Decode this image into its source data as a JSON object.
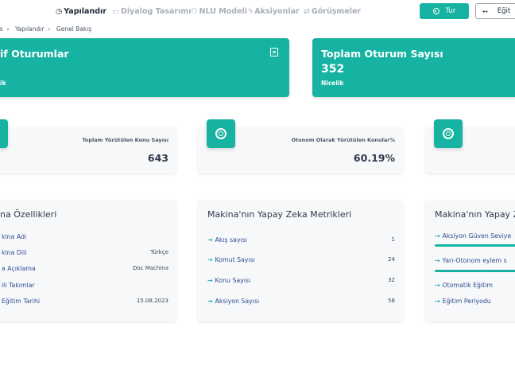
{
  "nav": {
    "items": [
      {
        "label": "Yapılandır",
        "icon": "clock-icon",
        "active": true
      },
      {
        "label": "Diyalog Tasarımı",
        "icon": "chat-icon",
        "active": false
      },
      {
        "label": "NLU Modeli",
        "icon": "users-icon",
        "active": false
      },
      {
        "label": "Aksiyonlar",
        "icon": "bolt-icon",
        "active": false
      },
      {
        "label": "Görüşmeler",
        "icon": "refresh-icon",
        "active": false
      }
    ],
    "run_label": "Tur",
    "train_label": "Eğit"
  },
  "breadcrumb": [
    "na",
    "Yapılandır",
    "Genel Bakış"
  ],
  "summary_cards": [
    {
      "title": "if Oturumlar",
      "value": "",
      "sub": "ik"
    },
    {
      "title": "Toplam Oturum Sayısı",
      "value": "352",
      "sub": "Nicelik"
    }
  ],
  "stats": [
    {
      "label": "Toplam Yürütülen Konu Sayısı",
      "value": "643"
    },
    {
      "label": "Otonom Olarak Yürütülen Konular%",
      "value": "60.19%"
    },
    {
      "label": "",
      "value": ""
    }
  ],
  "features_card": {
    "title": "na Özellikleri",
    "rows": [
      {
        "key": "kina Adı",
        "value": ""
      },
      {
        "key": "kina Dili",
        "value": "Türkçe"
      },
      {
        "key": "a Açıklama",
        "value": "Doc Machina"
      },
      {
        "key": "ili Takımlar",
        "value": ""
      },
      {
        "key": "Eğitim Tarihi",
        "value": "15.08.2023"
      }
    ]
  },
  "ai_metrics_card": {
    "title": "Makina'nın Yapay Zeka Metrikleri",
    "rows": [
      {
        "key": "Akış sayısı",
        "value": "1"
      },
      {
        "key": "Komut Sayısı",
        "value": "24"
      },
      {
        "key": "Konu Sayısı",
        "value": "32"
      },
      {
        "key": "Aksiyon Sayısı",
        "value": "58"
      }
    ]
  },
  "ai_extra_card": {
    "title": "Makina'nın Yapay Z",
    "rows": [
      {
        "key": "Aksiyon Güven Seviye"
      },
      {
        "key": "Yarı-Otonom eylem s"
      },
      {
        "key": "Otomatik Eğitim"
      },
      {
        "key": "Eğitim Periyodu"
      }
    ]
  },
  "colors": {
    "accent": "#16b3a2",
    "link": "#2f4a8f"
  }
}
